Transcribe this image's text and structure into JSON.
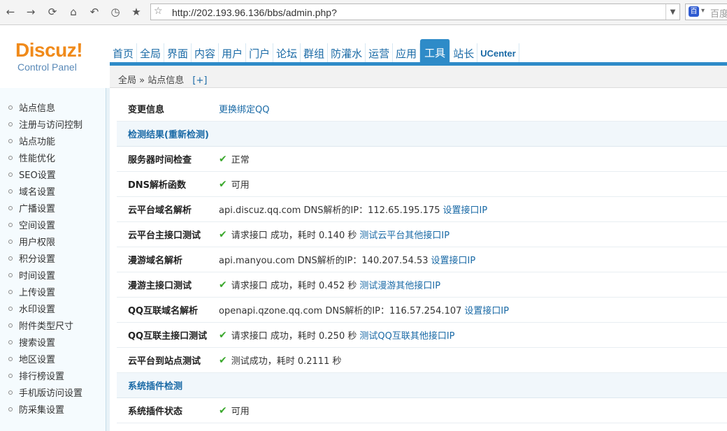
{
  "browser": {
    "url": "http://202.193.96.136/bbs/admin.php?",
    "search_placeholder": "百度",
    "back_icon": "←",
    "forward_icon": "→",
    "reload_icon": "⟳",
    "home_icon": "⌂",
    "undo_icon": "↶",
    "history_icon": "◷",
    "bookmark_icon": "★",
    "bookmark_outline_icon": "☆",
    "dropdown_icon": "▼",
    "search_drop_icon": "▾",
    "baidu_glyph": "百"
  },
  "logo": {
    "title": "Discuz!",
    "subtitle": "Control Panel"
  },
  "nav": {
    "items": [
      "首页",
      "全局",
      "界面",
      "内容",
      "用户",
      "门户",
      "论坛",
      "群组",
      "防灌水",
      "运营",
      "应用",
      "工具",
      "站长",
      "UCenter"
    ],
    "active": "工具"
  },
  "breadcrumb": {
    "root": "全局",
    "sep": "»",
    "current": "站点信息",
    "plus": "[+]"
  },
  "sidebar": {
    "items": [
      "站点信息",
      "注册与访问控制",
      "站点功能",
      "性能优化",
      "SEO设置",
      "域名设置",
      "广播设置",
      "空间设置",
      "用户权限",
      "积分设置",
      "时间设置",
      "上传设置",
      "水印设置",
      "附件类型尺寸",
      "搜索设置",
      "地区设置",
      "排行榜设置",
      "手机版访问设置",
      "防采集设置"
    ]
  },
  "main": {
    "rows": [
      {
        "label": "变更信息",
        "link": "更换绑定QQ"
      },
      {
        "section": "检测结果(重新检测)"
      },
      {
        "label": "服务器时间检查",
        "ok": true,
        "text": "正常"
      },
      {
        "label": "DNS解析函数",
        "ok": true,
        "text": "可用"
      },
      {
        "label": "云平台域名解析",
        "text": "api.discuz.qq.com DNS解析的IP：112.65.195.175",
        "link": "设置接口IP"
      },
      {
        "label": "云平台主接口测试",
        "ok": true,
        "text": "请求接口 成功，耗时 0.140 秒",
        "link": "测试云平台其他接口IP"
      },
      {
        "label": "漫游域名解析",
        "text": "api.manyou.com DNS解析的IP：140.207.54.53",
        "link": "设置接口IP"
      },
      {
        "label": "漫游主接口测试",
        "ok": true,
        "text": "请求接口 成功，耗时 0.452 秒",
        "link": "测试漫游其他接口IP"
      },
      {
        "label": "QQ互联域名解析",
        "text": "openapi.qzone.qq.com DNS解析的IP：116.57.254.107",
        "link": "设置接口IP"
      },
      {
        "label": "QQ互联主接口测试",
        "ok": true,
        "text": "请求接口 成功，耗时 0.250 秒",
        "link": "测试QQ互联其他接口IP"
      },
      {
        "label": "云平台到站点测试",
        "ok": true,
        "text": "测试成功，耗时 0.2111 秒"
      },
      {
        "section": "系统插件检测"
      },
      {
        "label": "系统插件状态",
        "ok": true,
        "text": "可用"
      }
    ],
    "check_icon": "✔"
  },
  "colors": {
    "accent": "#2e8bc8",
    "link": "#1a6aa6",
    "logo": "#f08a1a",
    "ok": "#3aa82c"
  }
}
